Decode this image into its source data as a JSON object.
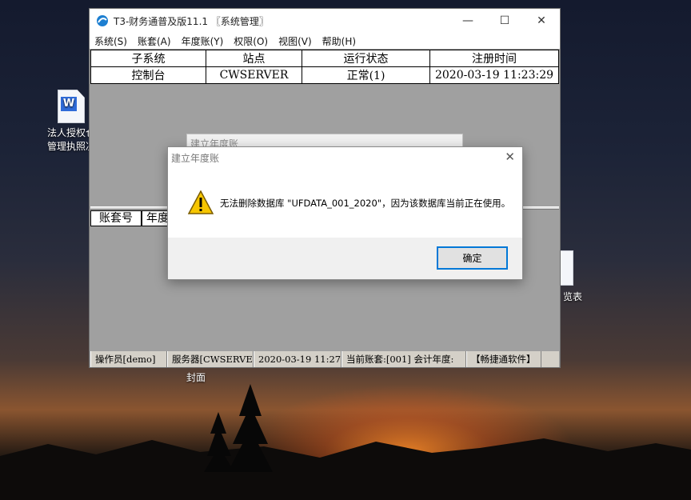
{
  "desktop": {
    "icon_doc_label_line1": "法人授权仓",
    "icon_doc_label_line2": "管理执照决",
    "icon_right_label": "览表",
    "icon_cover_label": "封面"
  },
  "window": {
    "title": "T3-财务通普及版11.1 〖系统管理〗",
    "menu": [
      "系统(S)",
      "账套(A)",
      "年度账(Y)",
      "权限(O)",
      "视图(V)",
      "帮助(H)"
    ],
    "table": {
      "headers": [
        "子系统",
        "站点",
        "运行状态",
        "注册时间"
      ],
      "rows": [
        [
          "控制台",
          "CWSERVER",
          "正常(1)",
          "2020-03-19 11:23:29"
        ]
      ]
    },
    "lower_headers": [
      "账套号",
      "年度"
    ],
    "status": [
      "操作员[demo]",
      "服务器[CWSERVER]",
      "2020-03-19 11:27",
      "当前账套:[001] 会计年度:",
      "【畅捷通软件】"
    ]
  },
  "bg_dialog": {
    "title": "建立年度账"
  },
  "msgbox": {
    "title": "建立年度账",
    "message": "无法删除数据库 \"UFDATA_001_2020\"，因为该数据库当前正在使用。",
    "ok_label": "确定"
  }
}
